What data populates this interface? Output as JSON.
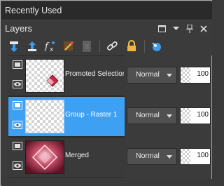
{
  "recent": {
    "title": "Recently Used"
  },
  "palette": {
    "title": "Layers",
    "controls": [
      {
        "name": "maximize-icon"
      },
      {
        "name": "dropdown-icon"
      },
      {
        "name": "pin-icon"
      },
      {
        "name": "close-icon"
      }
    ]
  },
  "toolbar": {
    "buttons": [
      {
        "name": "new-raster-layer-icon"
      },
      {
        "name": "new-vector-layer-icon"
      },
      {
        "name": "fx-effects-icon"
      },
      {
        "name": "brush-mask-icon"
      },
      {
        "name": "disabled-layer-icon"
      },
      {
        "name": "link-icon"
      },
      {
        "name": "lock-icon"
      },
      {
        "name": "group-properties-icon"
      }
    ]
  },
  "layers": [
    {
      "name": "Promoted Selection",
      "blend": "Normal",
      "opacity": "100",
      "selected": false,
      "thumb": "diamond"
    },
    {
      "name": "Group - Raster 1",
      "blend": "Normal",
      "opacity": "100",
      "selected": true,
      "thumb": "empty"
    },
    {
      "name": "Merged",
      "blend": "Normal",
      "opacity": "100",
      "selected": false,
      "thumb": "image"
    }
  ],
  "colors": {
    "selected_row": "#3ea0f2",
    "panel_bg": "#3b3b3b"
  }
}
